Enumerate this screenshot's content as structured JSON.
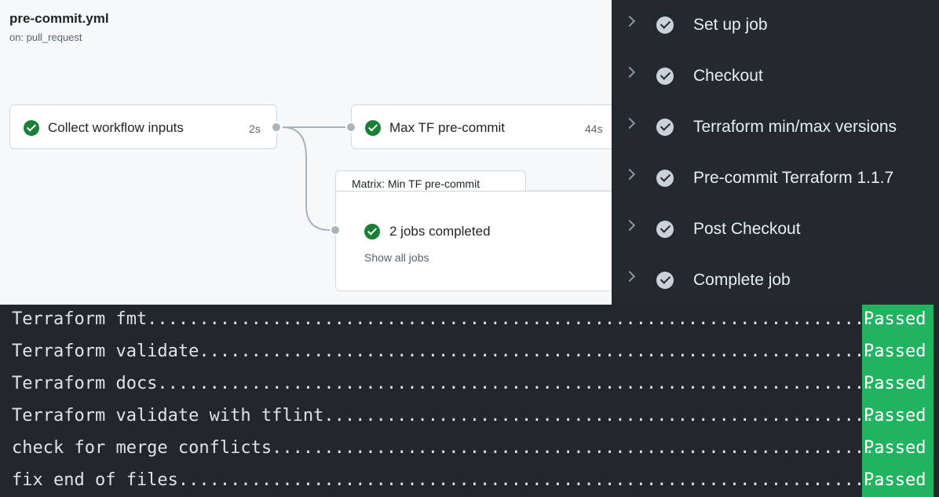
{
  "workflow": {
    "title": "pre-commit.yml",
    "trigger": "on: pull_request",
    "jobs": [
      {
        "name": "Collect workflow inputs",
        "duration": "2s"
      },
      {
        "name": "Max TF pre-commit",
        "duration": "44s"
      }
    ],
    "matrix": {
      "label": "Matrix: Min TF pre-commit",
      "summary": "2 jobs completed",
      "show_all": "Show all jobs"
    }
  },
  "steps": [
    {
      "label": "Set up job"
    },
    {
      "label": "Checkout"
    },
    {
      "label": "Terraform min/max versions"
    },
    {
      "label": "Pre-commit Terraform 1.1.7"
    },
    {
      "label": "Post Checkout"
    },
    {
      "label": "Complete job"
    }
  ],
  "terminal": {
    "lines": [
      {
        "text": "Terraform fmt.......................................................................",
        "result": "Passed"
      },
      {
        "text": "Terraform validate..................................................................",
        "result": "Passed"
      },
      {
        "text": "Terraform docs......................................................................",
        "result": "Passed"
      },
      {
        "text": "Terraform validate with tflint......................................................",
        "result": "Passed"
      },
      {
        "text": "check for merge conflicts...........................................................",
        "result": "Passed"
      },
      {
        "text": "fix end of files....................................................................",
        "result": "Passed"
      }
    ]
  },
  "colors": {
    "success": "#1a7f37",
    "passed_bg": "#22b361",
    "dark_panel": "#24292f",
    "terminal_bg": "#22272e"
  }
}
